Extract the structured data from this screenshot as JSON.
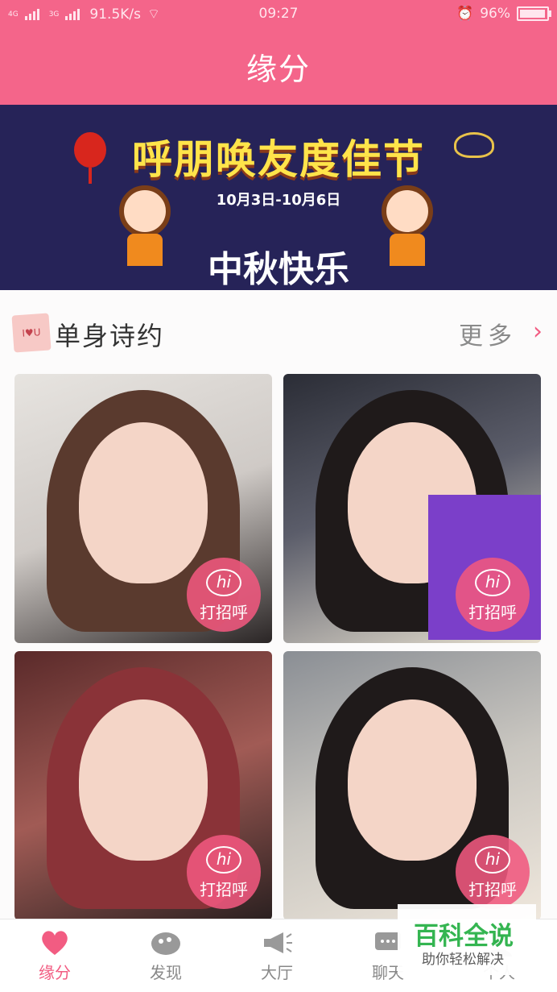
{
  "status_bar": {
    "net1": "4G",
    "net2": "3G",
    "speed": "91.5K/s",
    "time": "09:27",
    "battery": "96%"
  },
  "header": {
    "title": "缘分"
  },
  "banner": {
    "headline": "呼朋唤友度佳节",
    "date": "10月3日-10月6日",
    "subtitle": "中秋快乐"
  },
  "section": {
    "badge": "I♥U",
    "title": "单身诗约",
    "more_label": "更多"
  },
  "cards": [
    {
      "greet_icon": "hi",
      "greet_label": "打招呼"
    },
    {
      "greet_icon": "hi",
      "greet_label": "打招呼"
    },
    {
      "greet_icon": "hi",
      "greet_label": "打招呼"
    },
    {
      "greet_icon": "hi",
      "greet_label": "打招呼"
    }
  ],
  "tabs": [
    {
      "label": "缘分",
      "icon": "heart-icon"
    },
    {
      "label": "发现",
      "icon": "discover-icon"
    },
    {
      "label": "大厅",
      "icon": "megaphone-icon"
    },
    {
      "label": "聊天",
      "icon": "chat-icon"
    },
    {
      "label": "个人",
      "icon": "person-icon"
    }
  ],
  "watermark": {
    "brand": "百科全说",
    "tagline": "助你轻松解决"
  },
  "colors": {
    "brand_pink": "#f4658a",
    "accent": "#f25c82",
    "banner_bg": "#262358"
  }
}
